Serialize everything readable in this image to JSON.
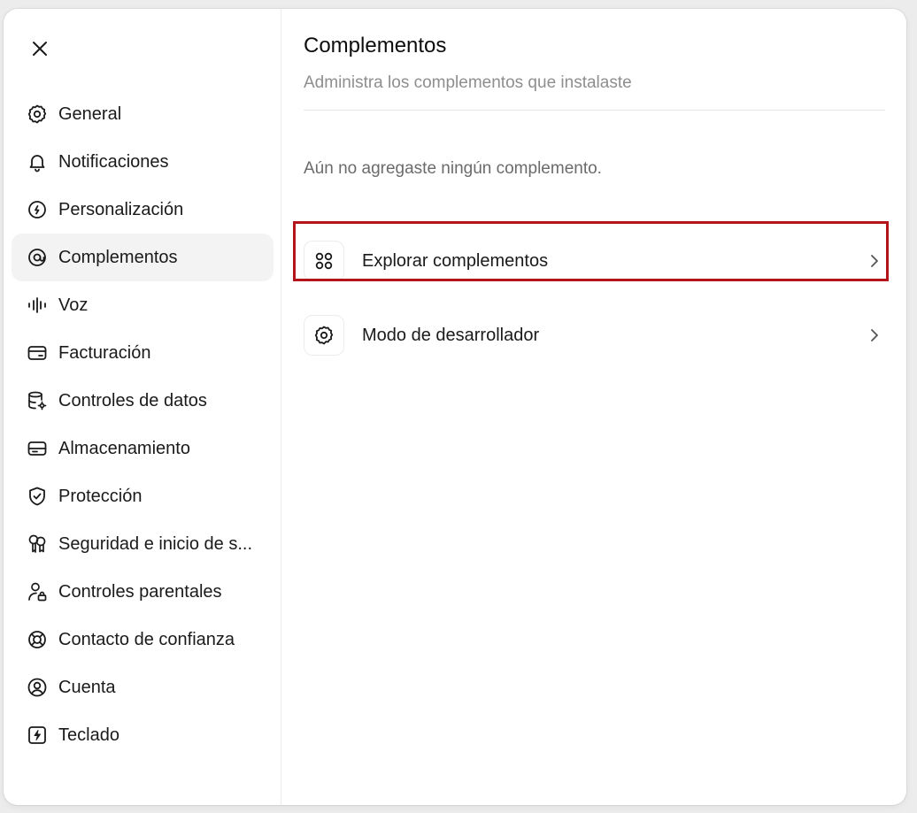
{
  "sidebar": {
    "close_label": "Cerrar",
    "items": [
      {
        "label": "General",
        "icon": "gear-icon",
        "active": false
      },
      {
        "label": "Notificaciones",
        "icon": "bell-icon",
        "active": false
      },
      {
        "label": "Personalización",
        "icon": "personalization-icon",
        "active": false
      },
      {
        "label": "Complementos",
        "icon": "plugin-icon",
        "active": true
      },
      {
        "label": "Voz",
        "icon": "waveform-icon",
        "active": false
      },
      {
        "label": "Facturación",
        "icon": "credit-card-icon",
        "active": false
      },
      {
        "label": "Controles de datos",
        "icon": "database-gear-icon",
        "active": false
      },
      {
        "label": "Almacenamiento",
        "icon": "storage-drive-icon",
        "active": false
      },
      {
        "label": "Protección",
        "icon": "shield-check-icon",
        "active": false
      },
      {
        "label": "Seguridad e inicio de s...",
        "icon": "keys-icon",
        "active": false
      },
      {
        "label": "Controles parentales",
        "icon": "person-lock-icon",
        "active": false
      },
      {
        "label": "Contacto de confianza",
        "icon": "lifebuoy-icon",
        "active": false
      },
      {
        "label": "Cuenta",
        "icon": "user-circle-icon",
        "active": false
      },
      {
        "label": "Teclado",
        "icon": "keyboard-bolt-icon",
        "active": false
      }
    ]
  },
  "main": {
    "title": "Complementos",
    "subtitle": "Administra los complementos que instalaste",
    "empty_message": "Aún no agregaste ningún complemento.",
    "rows": [
      {
        "label": "Explorar complementos",
        "icon": "apps-grid-icon"
      },
      {
        "label": "Modo de desarrollador",
        "icon": "gear-icon"
      }
    ]
  },
  "colors": {
    "highlight": "#b3141b",
    "active_bg": "#f3f3f3"
  }
}
